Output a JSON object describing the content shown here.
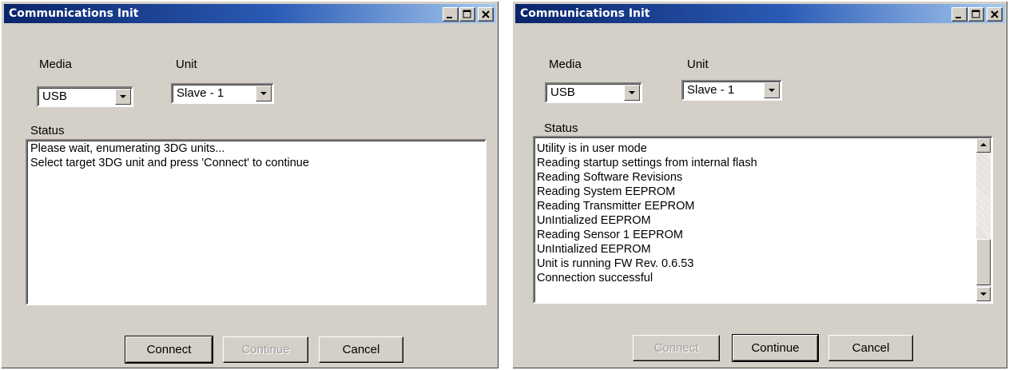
{
  "windows": [
    {
      "title": "Communications Init",
      "media_label": "Media",
      "unit_label": "Unit",
      "media_value": "USB",
      "unit_value": "Slave - 1",
      "status_label": "Status",
      "status_lines": [
        "Please wait, enumerating 3DG units...",
        "Select target 3DG unit and press 'Connect' to continue"
      ],
      "buttons": {
        "connect": "Connect",
        "continue": "Continue",
        "cancel": "Cancel"
      }
    },
    {
      "title": "Communications Init",
      "media_label": "Media",
      "unit_label": "Unit",
      "media_value": "USB",
      "unit_value": "Slave - 1",
      "status_label": "Status",
      "status_lines": [
        "Utility is in user mode",
        "Reading startup settings from internal flash",
        "Reading Software Revisions",
        "Reading System EEPROM",
        "Reading Transmitter EEPROM",
        "UnIntialized EEPROM",
        "Reading Sensor 1 EEPROM",
        "UnIntialized EEPROM",
        "Unit is running FW Rev. 0.6.53",
        "Connection successful"
      ],
      "buttons": {
        "connect": "Connect",
        "continue": "Continue",
        "cancel": "Cancel"
      }
    }
  ],
  "icons": {
    "minimize": "minimize-icon",
    "maximize": "maximize-icon",
    "close": "close-icon",
    "dropdown": "chevron-down-icon"
  },
  "colors": {
    "titlebar_start": "#0a246a",
    "titlebar_end": "#a6caf0",
    "face": "#d4d0c8"
  }
}
